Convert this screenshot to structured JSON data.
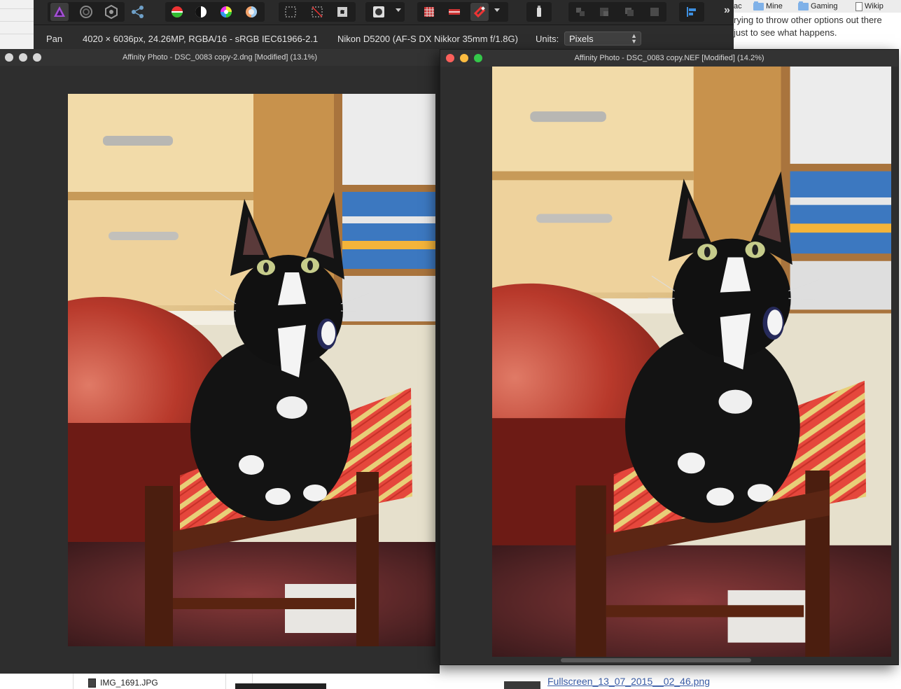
{
  "bookmarks": [
    {
      "label": "ac",
      "icon": "none"
    },
    {
      "label": "Mine",
      "icon": "folder-icon"
    },
    {
      "label": "Gaming",
      "icon": "folder-icon"
    },
    {
      "label": "Wikip",
      "icon": "page-icon"
    }
  ],
  "web_text": [
    "rying to throw other options out there",
    "just to see what happens."
  ],
  "finder": {
    "file_name": "IMG_1691.JPG",
    "link": "Fullscreen_13_07_2015__02_46.png"
  },
  "infobar": {
    "tool": "Pan",
    "doc_info": "4020 × 6036px, 24.26MP, RGBA/16 - sRGB IEC61966-2.1",
    "camera": "Nikon D5200 (AF-S DX Nikkor 35mm f/1.8G)",
    "units_label": "Units:",
    "units_value": "Pixels"
  },
  "windows": [
    {
      "title": "Affinity Photo - DSC_0083 copy-2.dng [Modified] (13.1%)",
      "active": false
    },
    {
      "title": "Affinity Photo - DSC_0083 copy.NEF [Modified] (14.2%)",
      "active": true
    }
  ],
  "colors": {
    "toolbar_bg": "#2a2a2a",
    "window_bg": "#2e2e2e",
    "traffic_close": "#fc605b",
    "traffic_min": "#fdbc40",
    "traffic_max": "#34c84a",
    "traffic_inactive": "#d6d6d6"
  }
}
